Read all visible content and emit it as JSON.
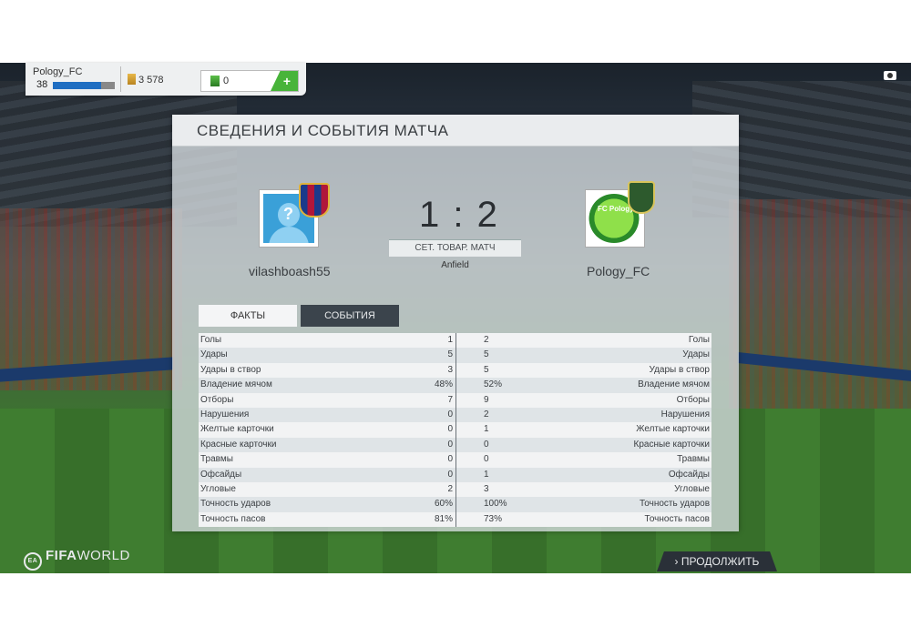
{
  "topbar": {
    "club_name": "Pology_FC",
    "level": "38",
    "xp_fraction": 0.78,
    "coins": "3 578",
    "points": "0",
    "add_label": "+"
  },
  "panel": {
    "title": "СВЕДЕНИЯ И СОБЫТИЯ МАТЧА",
    "home_team": "vilashboash55",
    "away_team": "Pology_FC",
    "away_crest_text": "FC Pology",
    "avatar_glyph": "?",
    "score": "1 : 2",
    "match_type": "СЕТ. ТОВАР. МАТЧ",
    "stadium": "Anfield",
    "tabs": {
      "facts": "ФАКТЫ",
      "events": "СОБЫТИЯ"
    },
    "stats": [
      {
        "label": "Голы",
        "home": "1",
        "away": "2"
      },
      {
        "label": "Удары",
        "home": "5",
        "away": "5"
      },
      {
        "label": "Удары в створ",
        "home": "3",
        "away": "5"
      },
      {
        "label": "Владение мячом",
        "home": "48%",
        "away": "52%"
      },
      {
        "label": "Отборы",
        "home": "7",
        "away": "9"
      },
      {
        "label": "Нарушения",
        "home": "0",
        "away": "2"
      },
      {
        "label": "Желтые карточки",
        "home": "0",
        "away": "1"
      },
      {
        "label": "Красные карточки",
        "home": "0",
        "away": "0"
      },
      {
        "label": "Травмы",
        "home": "0",
        "away": "0"
      },
      {
        "label": "Офсайды",
        "home": "0",
        "away": "1"
      },
      {
        "label": "Угловые",
        "home": "2",
        "away": "3"
      },
      {
        "label": "Точность ударов",
        "home": "60%",
        "away": "100%"
      },
      {
        "label": "Точность пасов",
        "home": "81%",
        "away": "73%"
      }
    ]
  },
  "footer": {
    "logo_ea": "EA",
    "logo_fifa": "FIFA",
    "logo_world": "WORLD",
    "continue_label": "› ПРОДОЛЖИТЬ"
  }
}
